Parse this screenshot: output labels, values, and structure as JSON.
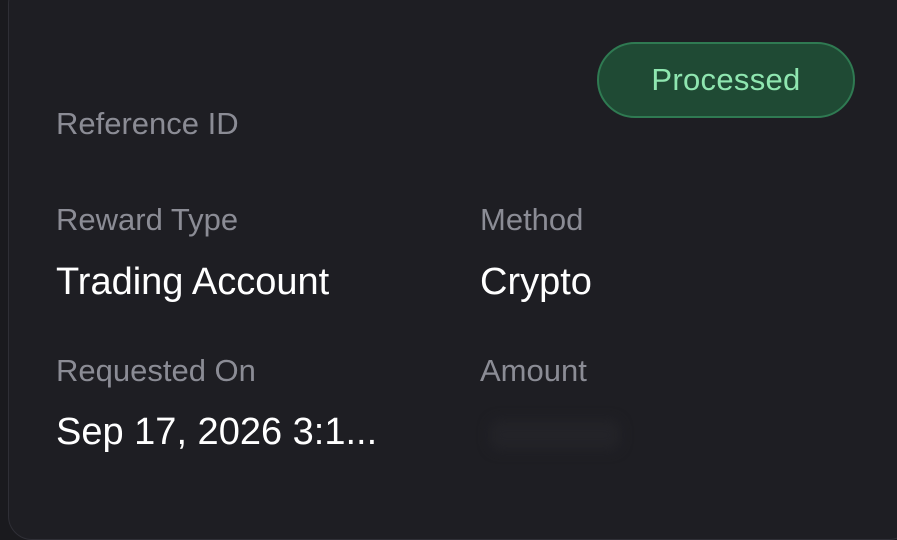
{
  "status": {
    "label": "Processed",
    "accent_color": "#8fe6b0"
  },
  "reference": {
    "label": "Reference ID"
  },
  "fields": {
    "reward_type": {
      "label": "Reward Type",
      "value": "Trading Account"
    },
    "method": {
      "label": "Method",
      "value": "Crypto"
    },
    "requested_on": {
      "label": "Requested On",
      "value": "Sep 17, 2026 3:1..."
    },
    "amount": {
      "label": "Amount"
    }
  }
}
